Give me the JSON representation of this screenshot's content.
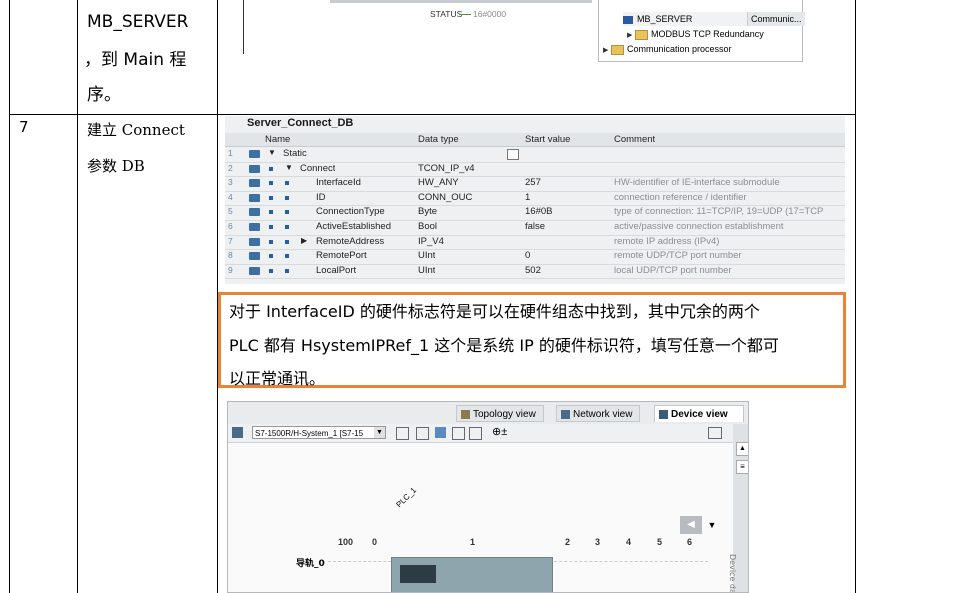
{
  "row6": {
    "col2_lines": [
      "MB_SERVER",
      "，到 Main 程",
      "序。"
    ],
    "status_label": "STATUS",
    "status_value": "16#0000",
    "tree": [
      {
        "label": "MB_SERVER",
        "extra": "Communic..."
      },
      {
        "label": "MODBUS TCP Redundancy"
      },
      {
        "label": "Communication processor"
      }
    ]
  },
  "row7": {
    "step": "7",
    "col2_lines": [
      "建立 Connect",
      "参数 DB"
    ],
    "db": {
      "title": "Server_Connect_DB",
      "headers": [
        "Name",
        "Data type",
        "Start value",
        "Comment"
      ],
      "rows": [
        {
          "n": "1",
          "name": "Static",
          "type": "",
          "start": "",
          "comment": ""
        },
        {
          "n": "2",
          "name": "Connect",
          "type": "TCON_IP_v4",
          "start": "",
          "comment": ""
        },
        {
          "n": "3",
          "name": "InterfaceId",
          "type": "HW_ANY",
          "start": "257",
          "comment": "HW-identifier of IE-interface submodule"
        },
        {
          "n": "4",
          "name": "ID",
          "type": "CONN_OUC",
          "start": "1",
          "comment": "connection reference / identifier"
        },
        {
          "n": "5",
          "name": "ConnectionType",
          "type": "Byte",
          "start": "16#0B",
          "comment": "type of connection: 11=TCP/IP, 19=UDP (17=TCP"
        },
        {
          "n": "6",
          "name": "ActiveEstablished",
          "type": "Bool",
          "start": "false",
          "comment": "active/passive connection establishment"
        },
        {
          "n": "7",
          "name": "RemoteAddress",
          "type": "IP_V4",
          "start": "",
          "comment": "remote IP address (IPv4)"
        },
        {
          "n": "8",
          "name": "RemotePort",
          "type": "UInt",
          "start": "0",
          "comment": "remote UDP/TCP port number"
        },
        {
          "n": "9",
          "name": "LocalPort",
          "type": "UInt",
          "start": "502",
          "comment": "local UDP/TCP port number"
        }
      ]
    },
    "note_lines": [
      "对于 InterfaceID 的硬件标志符是可以在硬件组态中找到，其中冗余的两个",
      "PLC 都有 HsystemIPRef_1 这个是系统 IP 的硬件标识符，填写任意一个都可",
      "以正常通讯。"
    ],
    "tia": {
      "tabs": [
        "Topology view",
        "Network view",
        "Device view"
      ],
      "device_select": "S7-1500R/H-System_1 [S7-15",
      "plc_label": "PLC_1",
      "rail_label": "导轨_0",
      "slots": [
        "100",
        "0",
        "1",
        "2",
        "3",
        "4",
        "5",
        "6"
      ],
      "side_label": "Device da"
    }
  },
  "colors": {
    "note_border": "#e8833a",
    "db_bg": "#eef0f1",
    "table_line": "#000000"
  }
}
